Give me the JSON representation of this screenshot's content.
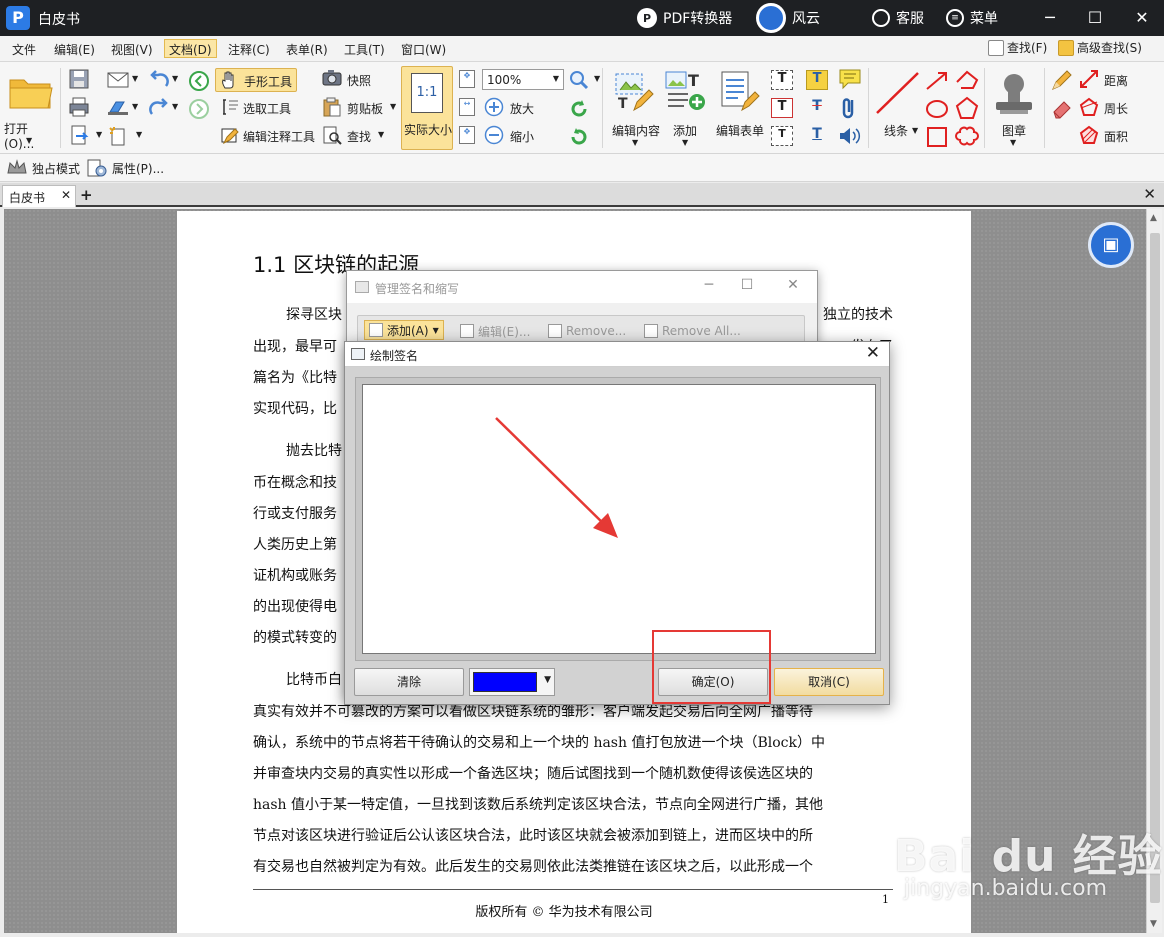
{
  "titlebar": {
    "app_name": "白皮书",
    "pdf_converter": "PDF转换器",
    "user": "风云",
    "service": "客服",
    "menu": "菜单"
  },
  "menubar": {
    "items": [
      "文件",
      "编辑(E)",
      "视图(V)",
      "文档(D)",
      "注释(C)",
      "表单(R)",
      "工具(T)",
      "窗口(W)"
    ],
    "find": "查找(F)",
    "advanced_find": "高级查找(S)"
  },
  "ribbon": {
    "open": "打开(O)...",
    "hand_tool": "手形工具",
    "select_tool": "选取工具",
    "edit_annotation_tool": "编辑注释工具",
    "snapshot": "快照",
    "clipboard": "剪贴板",
    "find": "查找",
    "actual_size": "实际大小",
    "actual_size_icon_text": "1:1",
    "zoom_value": "100%",
    "zoom_in": "放大",
    "zoom_out": "缩小",
    "edit_content": "编辑内容",
    "add": "添加",
    "edit_form": "编辑表单",
    "line": "线条",
    "stamp": "图章",
    "distance": "距离",
    "perimeter": "周长",
    "area": "面积"
  },
  "toolbar2": {
    "exclusive_mode": "独占模式",
    "properties": "属性(P)..."
  },
  "tabs": {
    "doc_tab": "白皮书"
  },
  "document": {
    "heading": "1.1 区块链的起源",
    "lines_left": [
      "探寻区块",
      "出现，最早可",
      "篇名为《比特",
      "实现代码，比",
      "抛去比特",
      "币在概念和技",
      "行或支付服务",
      "人类历史上第",
      "证机构或账务",
      "的出现使得电",
      "的模式转变的",
      "比特币白"
    ],
    "lines_right": [
      "独立的技术",
      "发布了"
    ],
    "lines_full": [
      "真实有效并不可篡改的方案可以看做区块链系统的雏形：客户端发起交易后向全网广播等待",
      "确认，系统中的节点将若干待确认的交易和上一个块的 hash 值打包放进一个块（Block）中",
      "并审查块内交易的真实性以形成一个备选区块；随后试图找到一个随机数使得该侯选区块的",
      "hash 值小于某一特定值，一旦找到该数后系统判定该区块合法，节点向全网进行广播，其他",
      "节点对该区块进行验证后公认该区块合法，此时该区块就会被添加到链上，进而区块中的所",
      "有交易也自然被判定为有效。此后发生的交易则依此法类推链在该区块之后，以此形成一个"
    ],
    "footer": "版权所有 © 华为技术有限公司",
    "page_number": "1"
  },
  "dialog_manage": {
    "title": "管理签名和缩写",
    "add": "添加(A)",
    "edit": "编辑(E)...",
    "remove": "Remove...",
    "remove_all": "Remove All..."
  },
  "dialog_draw": {
    "title": "绘制签名",
    "clear": "清除",
    "ok": "确定(O)",
    "cancel": "取消(C)",
    "pen_color": "#0000ff"
  },
  "watermark": {
    "main": "Bai du 经验",
    "sub": "jingyan.baidu.com"
  }
}
